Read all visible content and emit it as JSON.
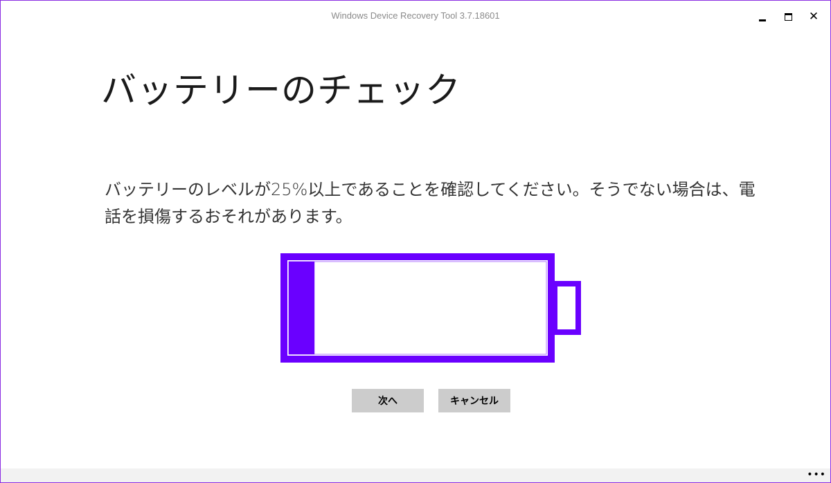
{
  "window": {
    "title": "Windows Device Recovery Tool 3.7.18601",
    "controls": {
      "minimize": "minimize-icon",
      "maximize": "maximize-icon",
      "close": "close-icon",
      "close_glyph": "✕"
    }
  },
  "page": {
    "heading": "バッテリーのチェック",
    "message": "バッテリーのレベルが25%以上であることを確認してください。そうでない場合は、電話を損傷するおそれがあります。"
  },
  "battery": {
    "icon": "battery-icon",
    "fill_fraction": 0.1,
    "color": "#6a00ff"
  },
  "buttons": {
    "next_label": "次へ",
    "cancel_label": "キャンセル",
    "background": "#cccccc"
  },
  "appbar": {
    "more_glyph": "•••",
    "more_icon": "more-options-icon"
  }
}
